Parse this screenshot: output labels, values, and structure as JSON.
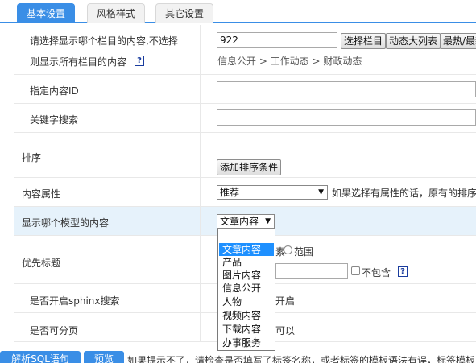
{
  "tabs": [
    {
      "label": "基本设置"
    },
    {
      "label": "风格样式"
    },
    {
      "label": "其它设置"
    }
  ],
  "rows": {
    "column": {
      "label_line1": "请选择显示哪个栏目的内容,不选择",
      "label_line2": "则显示所有栏目的内容",
      "help": "?",
      "value": "922",
      "btn_select": "选择栏目",
      "btn_dynamic": "动态大列表",
      "btn_hot": "最热/最新",
      "path": "信息公开 > 工作动态 > 财政动态"
    },
    "content_id": {
      "label": "指定内容ID",
      "value": ""
    },
    "keyword": {
      "label": "关键字搜索",
      "value": ""
    },
    "sort": {
      "label": "排序",
      "btn_add": "添加排序条件"
    },
    "attribute": {
      "label": "内容属性",
      "selected": "推荐",
      "note": "如果选择有属性的话，原有的排序"
    },
    "model": {
      "label": "显示哪个模型的内容",
      "selected": "文章内容"
    },
    "title": {
      "label": "优先标题",
      "radio_tail": "素",
      "radio_range": "范围",
      "exclude": "不包含",
      "help": "?"
    },
    "sphinx": {
      "label": "是否开启sphinx搜索",
      "tail": "开启"
    },
    "paging": {
      "label": "是否可分页",
      "tail": "可以"
    }
  },
  "dropdown": {
    "items": [
      "------",
      "文章内容",
      "产品",
      "图片内容",
      "信息公开",
      "人物",
      "视频内容",
      "下载内容",
      "办事服务"
    ],
    "selected_index": 1
  },
  "bottom": {
    "btn_sql": "解析SQL语句",
    "btn_preview": "预览",
    "note": "如果提示不了，请检查是否填写了标签名称，或者标签的模板语法有误，标签模板"
  },
  "colors": {
    "accent": "#3a8ee6",
    "highlight_row": "#e6f2fb",
    "dropdown_selected": "#1e90ff"
  },
  "icons": {
    "help": "help-icon",
    "dropdown_arrow": "chevron-down-icon"
  }
}
